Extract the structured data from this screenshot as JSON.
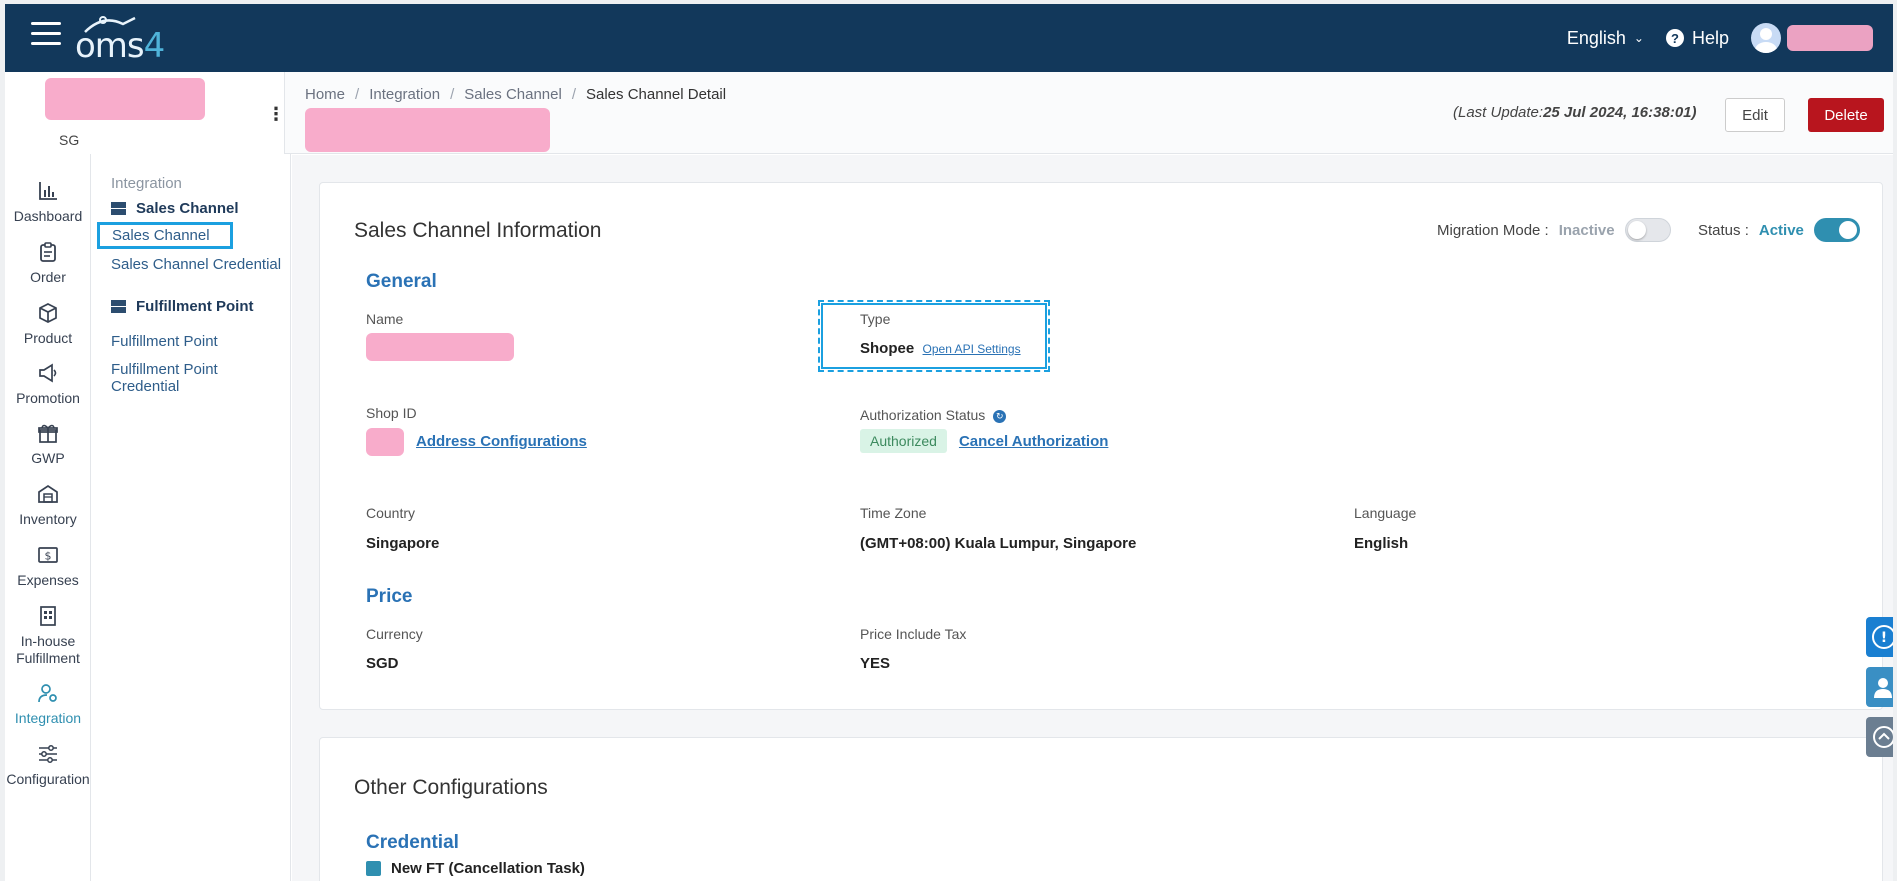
{
  "topbar": {
    "logo_main": "oms",
    "logo_num": "4",
    "language": "English",
    "help": "Help"
  },
  "store": {
    "code": "SG"
  },
  "breadcrumb": [
    "Home",
    "Integration",
    "Sales Channel",
    "Sales Channel Detail"
  ],
  "header": {
    "last_update_prefix": "(Last Update:",
    "last_update_value": "25 Jul 2024, 16:38:01)",
    "edit": "Edit",
    "delete": "Delete"
  },
  "nav": [
    {
      "label": "Dashboard",
      "icon": "chart-bar-icon"
    },
    {
      "label": "Order",
      "icon": "clipboard-icon"
    },
    {
      "label": "Product",
      "icon": "box-icon"
    },
    {
      "label": "Promotion",
      "icon": "megaphone-icon"
    },
    {
      "label": "GWP",
      "icon": "gift-icon"
    },
    {
      "label": "Inventory",
      "icon": "warehouse-icon"
    },
    {
      "label": "Expenses",
      "icon": "dollar-icon"
    },
    {
      "label": "In-house Fulfillment",
      "icon": "building-icon"
    },
    {
      "label": "Integration",
      "icon": "user-gear-icon"
    },
    {
      "label": "Configuration",
      "icon": "sliders-icon"
    }
  ],
  "subnav": {
    "group": "Integration",
    "sales_title": "Sales Channel",
    "sales_links": [
      "Sales Channel",
      "Sales Channel Credential"
    ],
    "fulfill_title": "Fulfillment Point",
    "fulfill_links": [
      "Fulfillment Point",
      "Fulfillment Point Credential"
    ]
  },
  "info_card": {
    "title": "Sales Channel Information",
    "migration_label": "Migration Mode :",
    "migration_state": "Inactive",
    "status_label": "Status :",
    "status_state": "Active",
    "general": "General",
    "name_label": "Name",
    "type_label": "Type",
    "type_value": "Shopee",
    "api_link": "Open API Settings",
    "shop_id_label": "Shop ID",
    "address_link": "Address Configurations",
    "auth_label": "Authorization Status",
    "auth_badge": "Authorized",
    "cancel_auth": "Cancel Authorization",
    "country_label": "Country",
    "country_value": "Singapore",
    "timezone_label": "Time Zone",
    "timezone_value": "(GMT+08:00) Kuala Lumpur, Singapore",
    "language_label": "Language",
    "language_value": "English",
    "price": "Price",
    "currency_label": "Currency",
    "currency_value": "SGD",
    "tax_label": "Price Include Tax",
    "tax_value": "YES"
  },
  "other_card": {
    "title": "Other Configurations",
    "credential": "Credential",
    "partial_text": "New FT (Cancellation Task)"
  },
  "colors": {
    "topbar": "#12385b",
    "accent": "#2f8fb0",
    "delete": "#b8151e",
    "link": "#2a72b5"
  }
}
